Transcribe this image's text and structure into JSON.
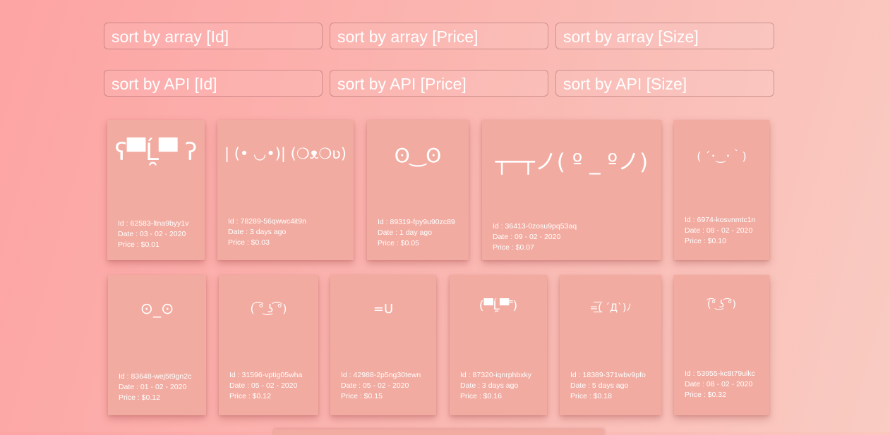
{
  "sort_buttons": {
    "array_id": "sort by array [Id]",
    "array_price": "sort by array [Price]",
    "array_size": "sort by array [Size]",
    "api_id": "sort by API [Id]",
    "api_price": "sort by API [Price]",
    "api_size": "sort by API [Size]"
  },
  "cards": [
    {
      "face": "ʕ▀̿Ĺ̯▀̿ ʔ",
      "id": "Id : 62583-ltna9byy1v",
      "date": "Date : 03 - 02 - 2020",
      "price": "Price : $0.01"
    },
    {
      "face": "| (• ◡•)| (❍ᴥ❍ʋ)",
      "id": "Id : 78289-56qwwc4it9n",
      "date": "Date : 3 days ago",
      "price": "Price : $0.03"
    },
    {
      "face": "ʘ‿ʘ",
      "id": "Id : 89319-fpy9u90zc89",
      "date": "Date : 1 day ago",
      "price": "Price : $0.05"
    },
    {
      "face": "┬─┬ノ( º _ ºノ)",
      "id": "Id : 36413-0zosu9pq53aq",
      "date": "Date : 09 - 02 - 2020",
      "price": "Price : $0.07"
    },
    {
      "face": "( ´･‿･｀)",
      "id": "Id : 6974-kosvnmtc1n",
      "date": "Date : 08 - 02 - 2020",
      "price": "Price : $0.10"
    },
    {
      "face": "⊙_⊙",
      "id": "Id : 83648-wej5t9gn2c",
      "date": "Date : 01 - 02 - 2020",
      "price": "Price : $0.12"
    },
    {
      "face": "( ͡° ͜ʖ ͡°)",
      "id": "Id : 31596-vptig05wha",
      "date": "Date : 05 - 02 - 2020",
      "price": "Price : $0.12"
    },
    {
      "face": "=U",
      "id": "Id : 42988-2p5ng30tewn",
      "date": "Date : 05 - 02 - 2020",
      "price": "Price : $0.15"
    },
    {
      "face": "(▀̿Ĺ̯▀̿ ̿)",
      "id": "Id : 87320-iqnrphbxky",
      "date": "Date : 3 days ago",
      "price": "Price : $0.16"
    },
    {
      "face": "=͟͟͞͞( ´Д`)ﾉ",
      "id": "Id : 18389-371wbv9pfo",
      "date": "Date : 5 days ago",
      "price": "Price : $0.18"
    },
    {
      "face": "(͡° ͜ʖ ͡°)",
      "id": "Id : 53955-kc8t79uikc",
      "date": "Date : 08 - 02 - 2020",
      "price": "Price : $0.32"
    }
  ]
}
